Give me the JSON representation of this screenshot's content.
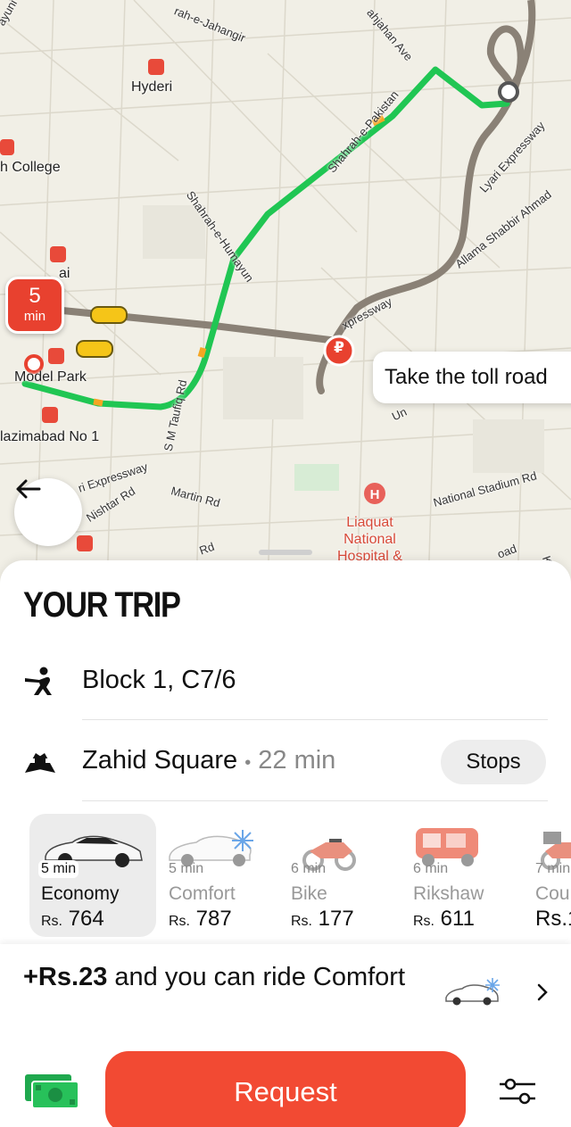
{
  "map": {
    "labels": {
      "hyderi": "Hyderi",
      "college": "h College",
      "model_park": "Model Park",
      "nazimabad": "lazimabad No 1",
      "hospital": "Liaquat\nNational\nHospital &",
      "bai": "ai"
    },
    "streets": {
      "top_left": "ayuni Rd",
      "jahangir": "rah-e-Jahangir",
      "jahan_ave": "ahjahan Ave",
      "pakistan": "Shahrah-e-Pakistan",
      "humayun": "Shahrah-e-Humayun",
      "lyari": "Lyari Expressway",
      "allama": "Allama Shabbir Ahmad",
      "expressway_mid": "xpressway",
      "tauhid": "S M Taufiq Rd",
      "ri_expressway": "ri Expressway",
      "nishtar": "Nishtar Rd",
      "martin": "Martin Rd",
      "national_stadium": "National Stadium Rd",
      "un": "Un",
      "rd_bottom": "Rd",
      "oad": "oad",
      "kar": "Kar"
    },
    "eta_pin": {
      "value": "5",
      "unit": "min"
    },
    "toll_hint": "Take the toll road",
    "toll_marker": "₽"
  },
  "trip": {
    "title": "YOUR TRIP",
    "pickup": "Block 1, C7/6",
    "destination": "Zahid Square",
    "destination_time": "22 min",
    "separator": "•",
    "stops_label": "Stops"
  },
  "tariffs": [
    {
      "time": "5 min",
      "name": "Economy",
      "currency": "Rs.",
      "price": "764",
      "selected": true
    },
    {
      "time": "5 min",
      "name": "Comfort",
      "currency": "Rs.",
      "price": "787",
      "selected": false
    },
    {
      "time": "6 min",
      "name": "Bike",
      "currency": "Rs.",
      "price": "177",
      "selected": false
    },
    {
      "time": "6 min",
      "name": "Rikshaw",
      "currency": "Rs.",
      "price": "611",
      "selected": false
    },
    {
      "time": "7 min",
      "name": "Cou",
      "currency": "Rs.",
      "price": "1",
      "selected": false
    }
  ],
  "upsell": {
    "amount": "+Rs.23",
    "text": "and you can ride Comfort"
  },
  "footer": {
    "request_label": "Request"
  },
  "colors": {
    "accent": "#f24a33",
    "route": "#20c653",
    "route_alt": "#8a8176"
  }
}
